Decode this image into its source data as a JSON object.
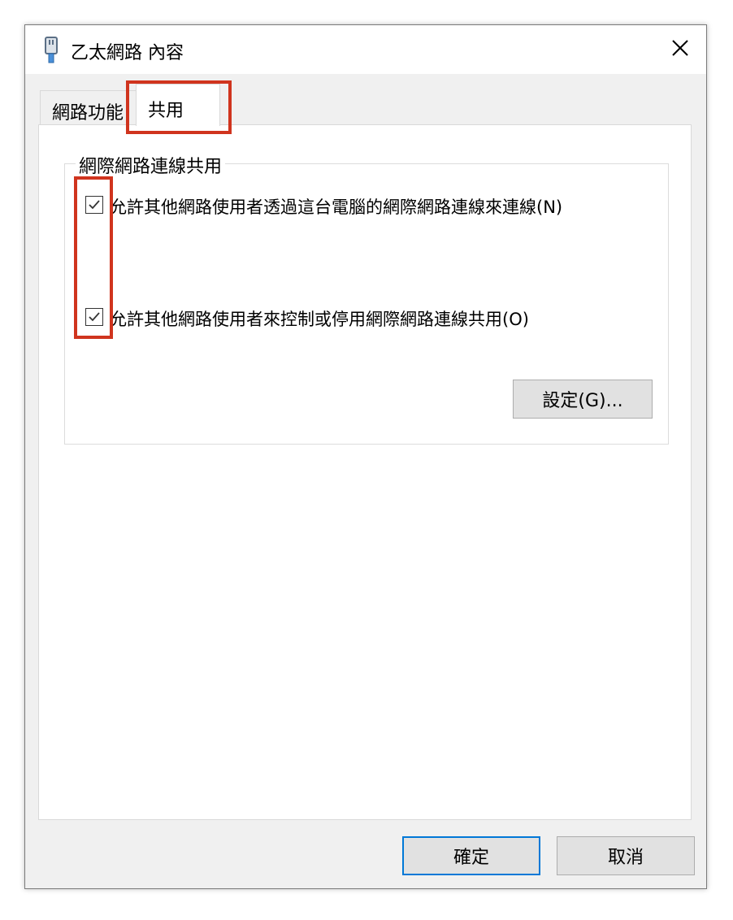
{
  "window": {
    "title": "乙太網路 內容",
    "title_icon": "ethernet-icon",
    "close_icon": "close-icon"
  },
  "tabs": [
    {
      "label": "網路功能",
      "selected": false
    },
    {
      "label": "共用",
      "selected": true
    }
  ],
  "sharing": {
    "group_label": "網際網路連線共用",
    "options": [
      {
        "label": "允許其他網路使用者透過這台電腦的網際網路連線來連線(N)",
        "checked": true
      },
      {
        "label": "允許其他網路使用者來控制或停用網際網路連線共用(O)",
        "checked": true
      }
    ],
    "settings_button": "設定(G)..."
  },
  "footer": {
    "ok_label": "確定",
    "cancel_label": "取消"
  },
  "colors": {
    "highlight": "#d0341e",
    "focus_border": "#0078d7",
    "window_bg": "#f0f0f0",
    "button_bg": "#e1e1e1"
  }
}
